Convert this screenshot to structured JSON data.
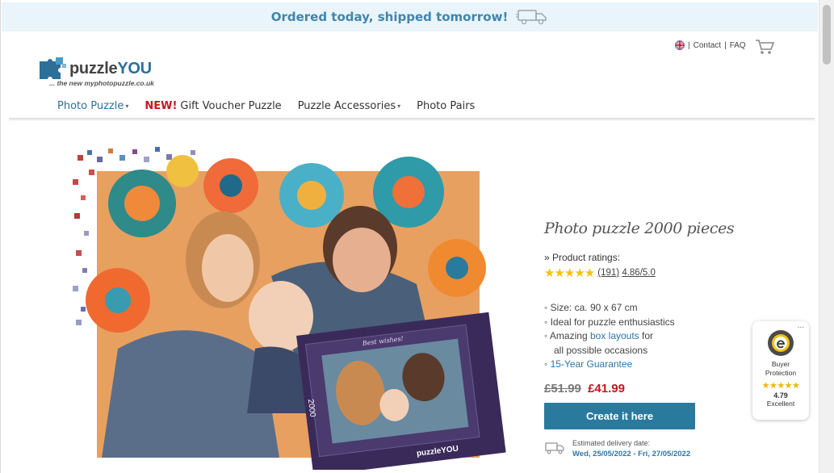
{
  "banner": {
    "text": "Ordered today, shipped tomorrow!"
  },
  "header": {
    "logo_name": "puzzleYOU",
    "logo_tagline": "... the new myphotopuzzle.co.uk",
    "links": {
      "contact": "Contact",
      "faq": "FAQ",
      "separator": "|"
    }
  },
  "nav": {
    "items": [
      {
        "label": "Photo Puzzle"
      },
      {
        "new_tag": "NEW!",
        "label": "Gift Voucher Puzzle"
      },
      {
        "label": "Puzzle Accessories"
      },
      {
        "label": "Photo Pairs"
      }
    ]
  },
  "product": {
    "title": "Photo puzzle 2000 pieces",
    "ratings_label": "» Product ratings:",
    "stars": "★★★★★",
    "rating_count": "(191)",
    "rating_value": "4.86/5.0",
    "features": [
      "◦ Size: ca. 90 x 67 cm",
      "◦ Ideal for puzzle enthusiastics",
      "◦ Amazing",
      "box layouts",
      "for",
      "all possible occasions",
      "◦",
      "15-Year Guarantee"
    ],
    "old_price": "£51.99",
    "new_price": "£41.99",
    "cta_label": "Create it here",
    "delivery_label": "Estimated delivery date:",
    "delivery_date": "Wed, 25/05/2022 - Fri, 27/05/2022",
    "box_greeting": "Best wishes!",
    "box_count": "2000",
    "box_brand": "puzzleYOU"
  },
  "trust_badge": {
    "more": "...",
    "label_line1": "Buyer",
    "label_line2": "Protection",
    "stars": "★★★★★",
    "score": "4.79",
    "rating_word": "Excellent"
  },
  "colors": {
    "accent": "#2a7a9e",
    "banner_bg": "#e9f4fb",
    "banner_text": "#3f86ad",
    "price_red": "#c0191f",
    "star_yellow": "#f4c20d"
  }
}
